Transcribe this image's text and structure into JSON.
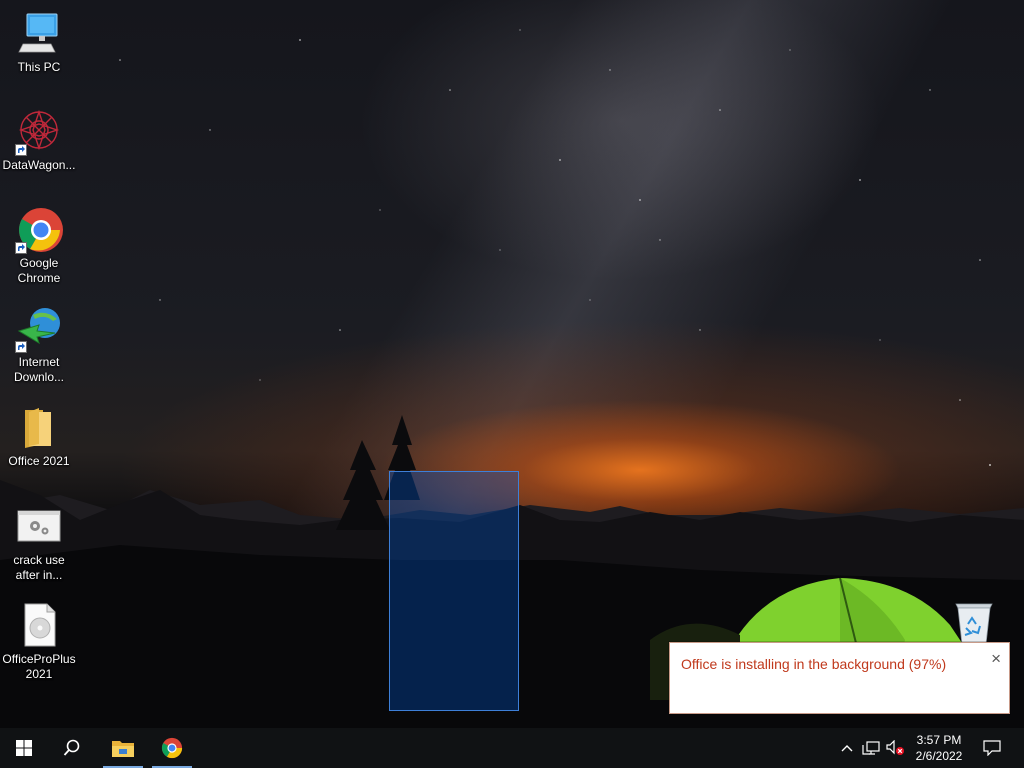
{
  "desktop": {
    "icons": [
      {
        "label": "This PC",
        "icon": "computer-icon"
      },
      {
        "label": "DataWagon...",
        "icon": "datawagon-icon"
      },
      {
        "label": "Google Chrome",
        "icon": "chrome-icon"
      },
      {
        "label": "Internet Downlo...",
        "icon": "idm-icon"
      },
      {
        "label": "Office 2021",
        "icon": "folder-icon"
      },
      {
        "label": "crack use after in...",
        "icon": "settings-file-icon"
      },
      {
        "label": "OfficeProPlus 2021",
        "icon": "disc-image-icon"
      }
    ],
    "recycle_bin_icon": "recycle-bin-icon"
  },
  "notification": {
    "message": "Office is installing in the background (97%)",
    "progress_percent": 97,
    "close_label": "×",
    "text_color": "#c0391c"
  },
  "taskbar": {
    "start_icon": "windows-logo-icon",
    "search_icon": "search-icon",
    "pinned": [
      "file-explorer-icon",
      "chrome-icon"
    ],
    "tray": {
      "chevron": "chevron-up-icon",
      "network": "network-icon",
      "volume": "volume-muted-icon",
      "notifications": "action-center-icon"
    },
    "clock": {
      "time": "3:57 PM",
      "date": "2/6/2022"
    },
    "accent": "#7aa9e0"
  }
}
